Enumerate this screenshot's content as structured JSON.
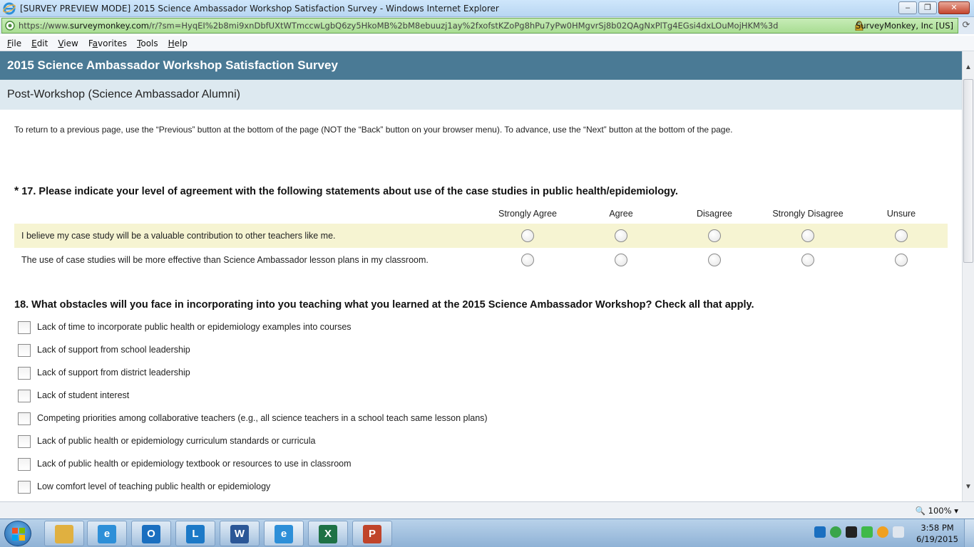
{
  "window": {
    "title": "[SURVEY PREVIEW MODE] 2015 Science Ambassador Workshop Satisfaction Survey - Windows Internet Explorer",
    "minimize": "–",
    "restore": "❐",
    "close": "✕"
  },
  "address": {
    "scheme": "https://www.",
    "host": "surveymonkey.com",
    "path": "/r/?sm=HyqEI%2b8mi9xnDbfUXtWTmccwLgbQ6zy5HkoMB%2bM8ebuuzj1ay%2fxofstKZoPg8hPu7yPw0HMgvrSj8b02QAgNxPlTg4EGsi4dxLOuMojHKM%3d",
    "certificate": "SurveyMonkey, Inc [US]"
  },
  "menu": {
    "items": [
      {
        "u": "F",
        "rest": "ile"
      },
      {
        "u": "E",
        "rest": "dit"
      },
      {
        "u": "V",
        "rest": "iew"
      },
      {
        "u": "",
        "pre": "F",
        "u2": "a",
        "rest": "vorites"
      },
      {
        "u": "T",
        "rest": "ools"
      },
      {
        "u": "H",
        "rest": "elp"
      }
    ]
  },
  "survey": {
    "title": "2015 Science Ambassador Workshop Satisfaction Survey",
    "page_title": "Post-Workshop (Science Ambassador Alumni)",
    "instructions": "To return to a previous page, use the “Previous” button at the bottom of the page (NOT the “Back” button on your browser menu). To advance, use the “Next” button at the bottom of the page.",
    "q17": {
      "required_mark": "*",
      "title": "17. Please indicate your level of agreement with the following statements about use of the case studies in public health/epidemiology.",
      "columns": [
        "Strongly Agree",
        "Agree",
        "Disagree",
        "Strongly Disagree",
        "Unsure"
      ],
      "rows": [
        {
          "label": "I believe my case study will be a valuable contribution to other teachers like me.",
          "selected": null
        },
        {
          "label": "The use of case studies will be more effective than Science Ambassador lesson plans in my classroom.",
          "selected": null
        }
      ]
    },
    "q18": {
      "title": "18. What obstacles will you face in incorporating into you teaching what you learned at the 2015 Science Ambassador Workshop? Check all that apply.",
      "options": [
        {
          "label": "Lack of time to incorporate public health or epidemiology examples into courses",
          "checked": false
        },
        {
          "label": "Lack of support from school leadership",
          "checked": false
        },
        {
          "label": "Lack of support from district leadership",
          "checked": false
        },
        {
          "label": "Lack of student interest",
          "checked": false
        },
        {
          "label": "Competing priorities among collaborative teachers (e.g., all science teachers in a school teach same lesson plans)",
          "checked": false
        },
        {
          "label": "Lack of public health or epidemiology curriculum standards or curricula",
          "checked": false
        },
        {
          "label": "Lack of public health or epidemiology textbook or resources to use in classroom",
          "checked": false
        },
        {
          "label": "Low comfort level of teaching public health or epidemiology",
          "checked": false
        }
      ]
    }
  },
  "status": {
    "zoom": "100%"
  },
  "taskbar": {
    "time": "3:58 PM",
    "date": "6/19/2015",
    "apps": [
      {
        "name": "file-explorer",
        "glyph": "",
        "color": "#e0b040"
      },
      {
        "name": "internet-explorer",
        "glyph": "e",
        "color": "#2d8fd8"
      },
      {
        "name": "outlook",
        "glyph": "O",
        "color": "#1a6fc0"
      },
      {
        "name": "lync",
        "glyph": "L",
        "color": "#1c79c7"
      },
      {
        "name": "word",
        "glyph": "W",
        "color": "#2b5797"
      },
      {
        "name": "internet-explorer-active",
        "glyph": "e",
        "color": "#2d8fd8"
      },
      {
        "name": "excel",
        "glyph": "X",
        "color": "#1e7145"
      },
      {
        "name": "powerpoint",
        "glyph": "P",
        "color": "#c0442a"
      }
    ],
    "tray_icons": [
      {
        "name": "outlook-tray-icon",
        "color": "#1a6fc0"
      },
      {
        "name": "sync-tray-icon",
        "color": "#3aa54a"
      },
      {
        "name": "media-tray-icon",
        "color": "#222222"
      },
      {
        "name": "check-tray-icon",
        "color": "#3fb94a"
      },
      {
        "name": "alert-tray-icon",
        "color": "#f0a020"
      },
      {
        "name": "volume-tray-icon",
        "color": "#dfe6ee"
      }
    ]
  },
  "colors": {
    "header_bg": "#4a7a95",
    "subheader_bg": "#dde9f0",
    "row_highlight": "#f6f4d2",
    "address_bg": "#b6e3a0"
  }
}
